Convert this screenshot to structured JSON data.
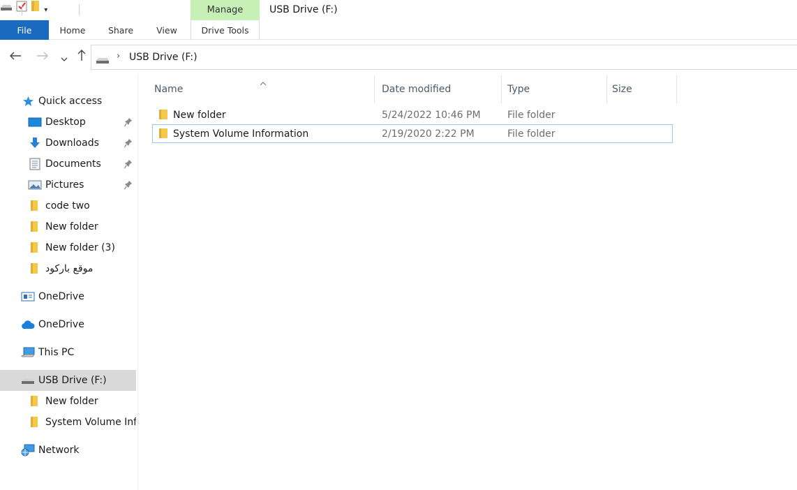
{
  "quick_access_toolbar": {
    "icons": [
      "drive-icon",
      "properties-check-icon",
      "new-folder-icon",
      "customize-dropdown-icon"
    ]
  },
  "ribbon": {
    "context_group": "Manage",
    "window_title": "USB Drive (F:)",
    "tabs": {
      "file": "File",
      "home": "Home",
      "share": "Share",
      "view": "View",
      "drive_tools": "Drive Tools"
    }
  },
  "address_bar": {
    "separator": "›",
    "breadcrumb": "USB Drive (F:)"
  },
  "columns": {
    "name": "Name",
    "date_modified": "Date modified",
    "type": "Type",
    "size": "Size"
  },
  "files": [
    {
      "name": "New folder",
      "date": "5/24/2022 10:46 PM",
      "type": "File folder",
      "size": ""
    },
    {
      "name": "System Volume Information",
      "date": "2/19/2020 2:22 PM",
      "type": "File folder",
      "size": ""
    }
  ],
  "sidebar": {
    "quick_access": "Quick access",
    "pinned": [
      {
        "label": "Desktop",
        "icon": "desktop-icon"
      },
      {
        "label": "Downloads",
        "icon": "download-icon"
      },
      {
        "label": "Documents",
        "icon": "documents-icon"
      },
      {
        "label": "Pictures",
        "icon": "pictures-icon"
      }
    ],
    "folders": [
      "code two",
      "New folder",
      "New folder (3)",
      "موقع باركود"
    ],
    "onedrive_1": "OneDrive",
    "onedrive_2": "OneDrive",
    "this_pc": "This PC",
    "usb_drive": "USB Drive (F:)",
    "usb_children": [
      "New folder",
      "System Volume Information"
    ],
    "network": "Network"
  },
  "colors": {
    "file_tab": "#1a6bbf",
    "manage_bg": "#c7f0b6",
    "selected_nav": "#d9d9d9",
    "focus_border": "#99c9ef",
    "folder": "#f3c94a"
  }
}
